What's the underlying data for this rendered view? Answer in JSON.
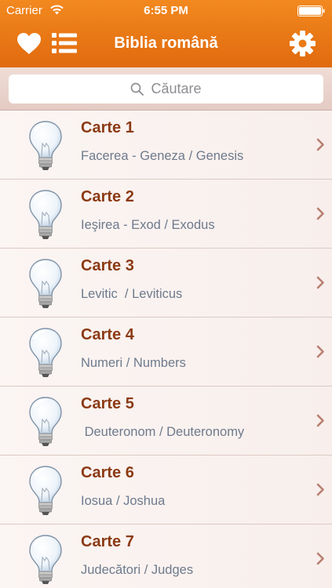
{
  "status_bar": {
    "carrier": "Carrier",
    "time": "6:55 PM"
  },
  "nav": {
    "title": "Biblia română",
    "left_icons": [
      "heart-icon",
      "list-icon"
    ],
    "right_icon": "gear-icon"
  },
  "search": {
    "placeholder": "Căutare",
    "icon": "search-icon"
  },
  "colors": {
    "header": "#ea7b17",
    "title_text": "#8b3a14",
    "subtitle_text": "#6e7a8c",
    "chevron": "#b97f6f"
  },
  "books": [
    {
      "title": "Carte 1",
      "subtitle": "Facerea - Geneza / Genesis"
    },
    {
      "title": "Carte 2",
      "subtitle": "Ieşirea - Exod / Exodus"
    },
    {
      "title": "Carte 3",
      "subtitle": "Levitic  / Leviticus"
    },
    {
      "title": "Carte 4",
      "subtitle": "Numeri / Numbers"
    },
    {
      "title": "Carte 5",
      "subtitle": " Deuteronom / Deuteronomy"
    },
    {
      "title": "Carte 6",
      "subtitle": "Iosua / Joshua"
    },
    {
      "title": "Carte 7",
      "subtitle": "Judecători / Judges"
    }
  ]
}
